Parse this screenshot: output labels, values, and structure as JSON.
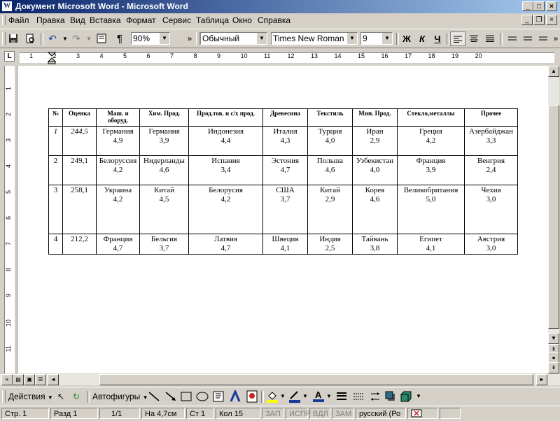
{
  "window": {
    "title": "Документ Microsoft Word - Microsoft Word"
  },
  "menu": {
    "items": [
      "Файл",
      "Правка",
      "Вид",
      "Вставка",
      "Формат",
      "Сервис",
      "Таблица",
      "Окно",
      "Справка"
    ]
  },
  "toolbar": {
    "zoom": "90%",
    "style": "Обычный",
    "font": "Times New Roman",
    "size": "9",
    "bold": "Ж",
    "italic": "К",
    "underline": "Ч",
    "overflow": "»"
  },
  "ruler": {
    "tab_label": "L",
    "h_numbers": [
      "1",
      "2",
      "3",
      "4",
      "5",
      "6",
      "7",
      "8",
      "9",
      "10",
      "11",
      "12",
      "13",
      "14",
      "15",
      "16",
      "17",
      "18",
      "19",
      "20"
    ],
    "v_numbers": [
      "1",
      "2",
      "3",
      "4",
      "5",
      "6",
      "7",
      "8",
      "9",
      "10",
      "11"
    ]
  },
  "table": {
    "headers": [
      "№",
      "Оценка",
      "Маш. и оборуд.",
      "Хим. Прод.",
      "Прод.тов. и с/х прод.",
      "Древесина",
      "Текстиль",
      "Мин. Прод.",
      "Стекло,металлы",
      "Прочее"
    ],
    "rows": [
      [
        {
          "text": "1",
          "italic": true
        },
        {
          "text": "244,5",
          "italic": true
        },
        {
          "text": "Германия",
          "val": "4,9"
        },
        {
          "text": "Германия",
          "val": "3,9"
        },
        {
          "text": "Индонезия",
          "val": "4,4"
        },
        {
          "text": "Италия",
          "val": "4,3"
        },
        {
          "text": "Турция",
          "val": "4,0"
        },
        {
          "text": "Иран",
          "val": "2,9"
        },
        {
          "text": "Греция",
          "val": "4,2"
        },
        {
          "text": "Азербайджан",
          "val": "3,3"
        }
      ],
      [
        {
          "text": "2"
        },
        {
          "text": "249,1"
        },
        {
          "text": "Белоруссия",
          "val": "4,2"
        },
        {
          "text": "Нидерланды",
          "val": "4,6"
        },
        {
          "text": "Испания",
          "val": "3,4"
        },
        {
          "text": "Эстония",
          "val": "4,7"
        },
        {
          "text": "Польша",
          "val": "4,6"
        },
        {
          "text": "Узбекистан",
          "val": "4,0"
        },
        {
          "text": "Франция",
          "val": "3,9"
        },
        {
          "text": "Венгрия",
          "val": "2,4"
        }
      ],
      [
        {
          "text": "3"
        },
        {
          "text": "258,1"
        },
        {
          "text": "Украина",
          "val": "4,2"
        },
        {
          "text": "Китай",
          "val": "4,5"
        },
        {
          "text": "Белорусия",
          "val": "4,2"
        },
        {
          "text": "США",
          "val": "3,7"
        },
        {
          "text": "Китай",
          "val": "2,9"
        },
        {
          "text": "Корея",
          "val": "4,6"
        },
        {
          "text": "Великобритания",
          "val": "5,0"
        },
        {
          "text": "Чехия",
          "val": "3,0"
        }
      ],
      [
        {
          "text": "4"
        },
        {
          "text": "212,2"
        },
        {
          "text": "Франция",
          "val": "4,7"
        },
        {
          "text": "Бельгия",
          "val": "3,7"
        },
        {
          "text": "Латвия",
          "val": "4,7"
        },
        {
          "text": "Швеция",
          "val": "4,1"
        },
        {
          "text": "Индия",
          "val": "2,5"
        },
        {
          "text": "Тайвань",
          "val": "3,8"
        },
        {
          "text": "Египет",
          "val": "4,1"
        },
        {
          "text": "Австрия",
          "val": "3,0"
        }
      ]
    ]
  },
  "drawing": {
    "actions": "Действия",
    "autoshapes": "Автофигуры"
  },
  "status": {
    "page": "Стр. 1",
    "section": "Разд 1",
    "pages": "1/1",
    "at": "На 4,7см",
    "line": "Ст 1",
    "col": "Кол 15",
    "rec": "ЗАП",
    "trk": "ИСПР",
    "ext": "ВДЛ",
    "ovr": "ЗАМ",
    "language": "русский (Ро"
  }
}
